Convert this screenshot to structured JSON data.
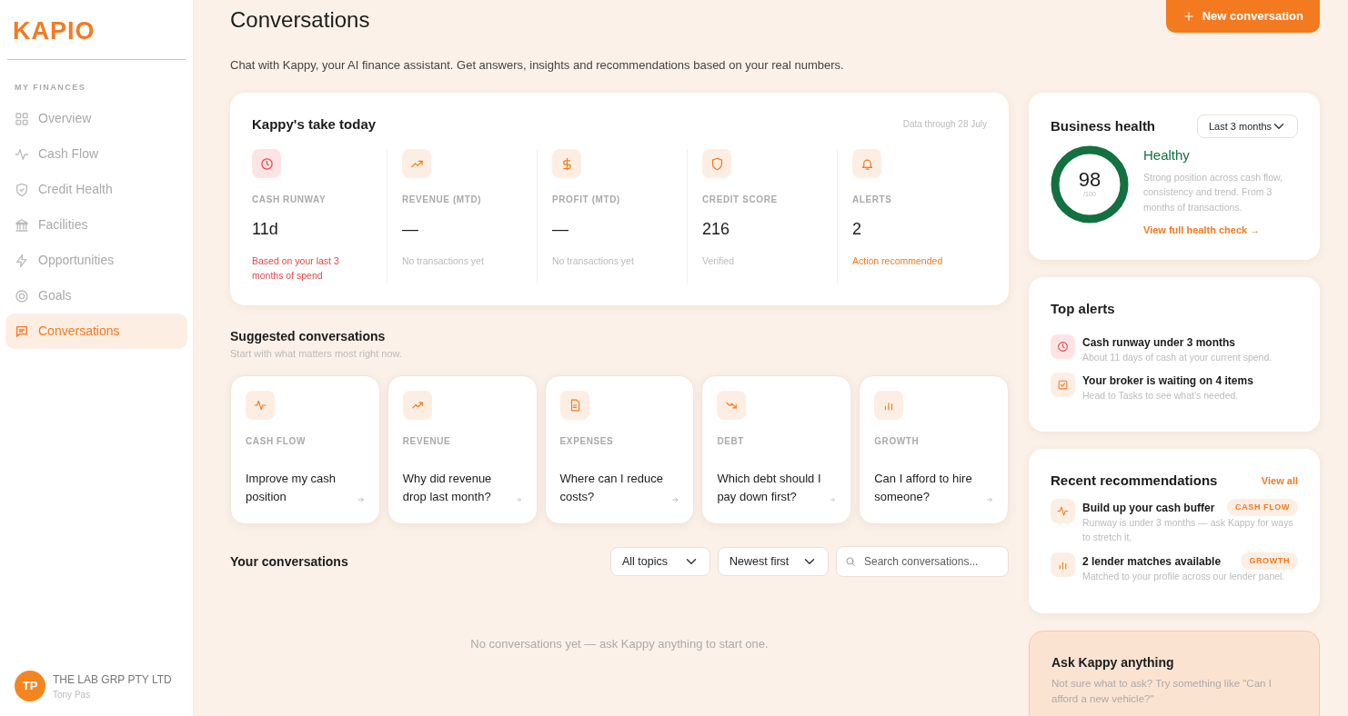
{
  "sidebar": {
    "logo": "KAPIO",
    "section": "MY FINANCES",
    "items": [
      {
        "label": "Overview",
        "selected": false
      },
      {
        "label": "Cash Flow",
        "selected": false
      },
      {
        "label": "Credit Health",
        "selected": false
      },
      {
        "label": "Facilities",
        "selected": false
      },
      {
        "label": "Opportunities",
        "selected": false
      },
      {
        "label": "Goals",
        "selected": false
      },
      {
        "label": "Conversations",
        "selected": true
      }
    ],
    "user": {
      "initials": "TP",
      "company": "THE LAB GRP PTY LTD",
      "name": "Tony Pas"
    }
  },
  "header": {
    "title": "Conversations",
    "button": "New conversation",
    "subtitle": "Chat with Kappy, your AI finance assistant. Get answers, insights and recommendations based on your real numbers."
  },
  "take": {
    "title": "Kappy's take today",
    "date": "Data through 28 July",
    "metrics": [
      {
        "label": "CASH RUNWAY",
        "value": "11d",
        "note": "Based on your last 3 months of spend",
        "kind": "danger"
      },
      {
        "label": "REVENUE (MTD)",
        "value": "—",
        "note": "No transactions yet",
        "kind": "muted"
      },
      {
        "label": "PROFIT (MTD)",
        "value": "—",
        "note": "No transactions yet",
        "kind": "muted"
      },
      {
        "label": "CREDIT SCORE",
        "value": "216",
        "note": "Verified",
        "kind": "muted"
      },
      {
        "label": "ALERTS",
        "value": "2",
        "note": "Action recommended",
        "kind": "warning"
      }
    ]
  },
  "suggested": {
    "title": "Suggested conversations",
    "subtitle": "Start with what matters most right now.",
    "cards": [
      {
        "topic": "CASH FLOW",
        "question": "Improve my cash position"
      },
      {
        "topic": "REVENUE",
        "question": "Why did revenue drop last month?"
      },
      {
        "topic": "EXPENSES",
        "question": "Where can I reduce costs?"
      },
      {
        "topic": "DEBT",
        "question": "Which debt should I pay down first?"
      },
      {
        "topic": "GROWTH",
        "question": "Can I afford to hire someone?"
      }
    ]
  },
  "your_conversations": {
    "title": "Your conversations",
    "topic_filter": "All topics",
    "sort": "Newest first",
    "search": {
      "placeholder": "Search conversations..."
    },
    "empty": "No conversations yet — ask Kappy anything to start one."
  },
  "health": {
    "title": "Business health",
    "period": "Last 3 months",
    "score": "98",
    "out_of": "/100",
    "status": "Healthy",
    "description": "Strong position across cash flow, consistency and trend. From 3 months of transactions.",
    "link": "View full health check →"
  },
  "alerts": {
    "title": "Top alerts",
    "items": [
      {
        "title": "Cash runway under 3 months",
        "detail": "About 11 days of cash at your current spend.",
        "kind": "danger"
      },
      {
        "title": "Your broker is waiting on 4 items",
        "detail": "Head to Tasks to see what’s needed.",
        "kind": "warning"
      }
    ]
  },
  "recommendations": {
    "title": "Recent recommendations",
    "link": "View all",
    "items": [
      {
        "title": "Build up your cash buffer",
        "tag": "CASH FLOW",
        "detail": "Runway is under 3 months — ask Kappy for ways to stretch it."
      },
      {
        "title": "2 lender matches available",
        "tag": "GROWTH",
        "detail": "Matched to your profile across our lender panel."
      }
    ]
  },
  "ask": {
    "title": "Ask Kappy anything",
    "text": "Not sure what to ask? Try something like \"Can I afford a new vehicle?\""
  }
}
